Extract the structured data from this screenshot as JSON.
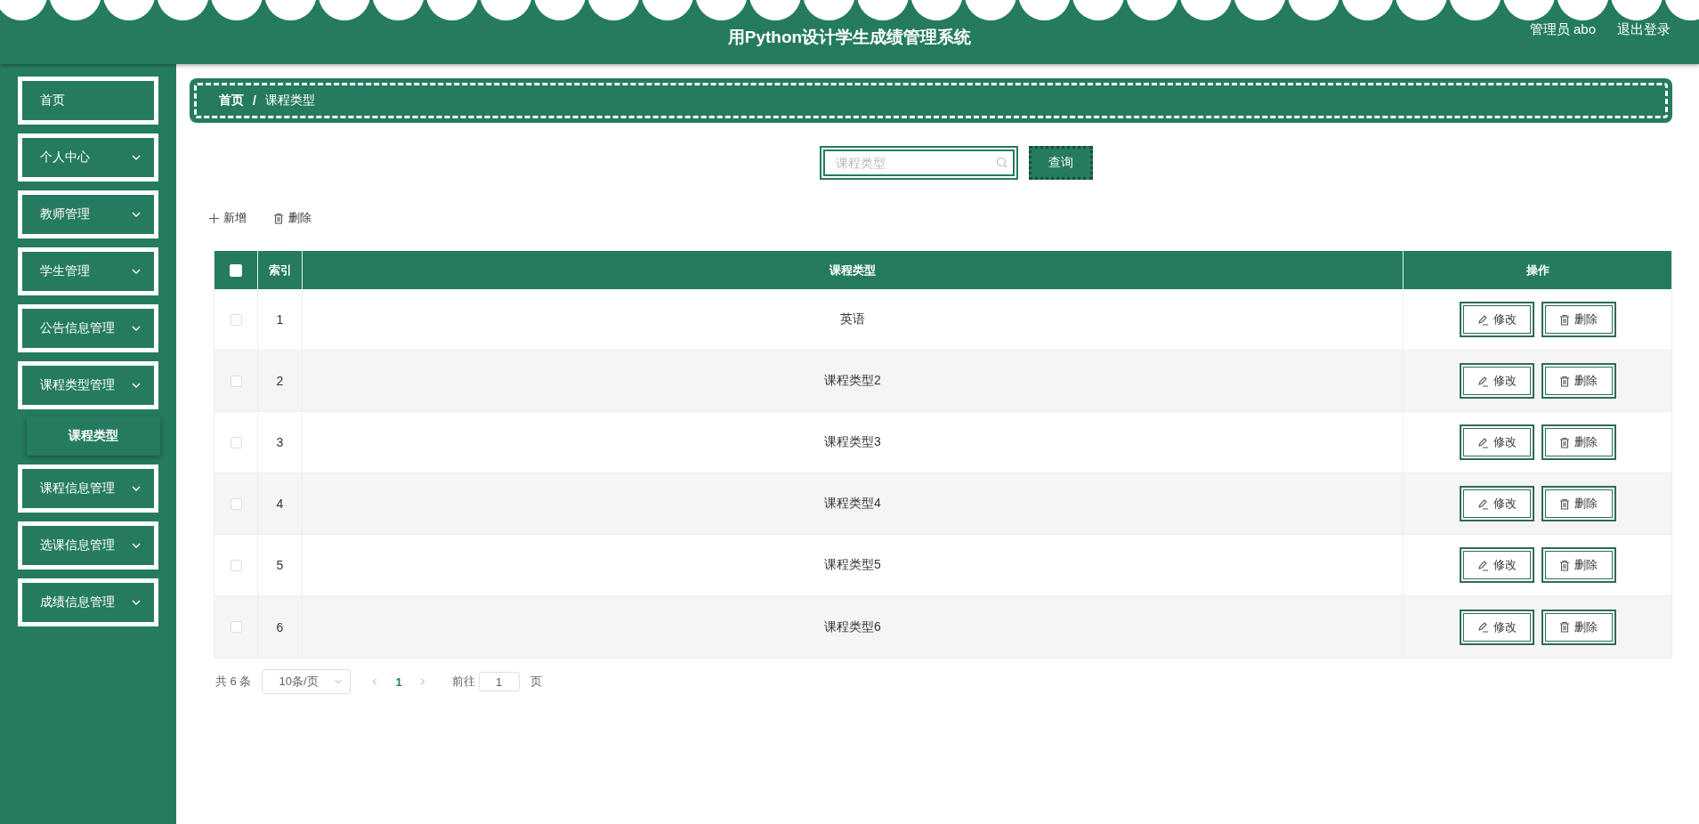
{
  "header": {
    "title": "用Python设计学生成绩管理系统",
    "user": "管理员 abo",
    "logout": "退出登录"
  },
  "sidebar": {
    "items": [
      {
        "label": "首页",
        "kind": "link"
      },
      {
        "label": "个人中心",
        "kind": "menu"
      },
      {
        "label": "教师管理",
        "kind": "menu"
      },
      {
        "label": "学生管理",
        "kind": "menu"
      },
      {
        "label": "公告信息管理",
        "kind": "menu"
      },
      {
        "label": "课程类型管理",
        "kind": "menu",
        "children": [
          {
            "label": "课程类型",
            "selected": true
          }
        ]
      },
      {
        "label": "课程信息管理",
        "kind": "menu"
      },
      {
        "label": "选课信息管理",
        "kind": "menu"
      },
      {
        "label": "成绩信息管理",
        "kind": "menu"
      }
    ]
  },
  "breadcrumb": [
    "首页",
    "课程类型"
  ],
  "breadcrumb_separator": "/",
  "search": {
    "placeholder": "课程类型",
    "button": "查询"
  },
  "toolbar": {
    "add": "新增",
    "delete": "删除"
  },
  "table": {
    "columns": [
      "索引",
      "课程类型",
      "操作"
    ],
    "select_all_checked": false,
    "rows": [
      {
        "index": "1",
        "type": "英语",
        "checked": false,
        "edit": "修改",
        "delete": "删除"
      },
      {
        "index": "2",
        "type": "课程类型2",
        "checked": false,
        "edit": "修改",
        "delete": "删除"
      },
      {
        "index": "3",
        "type": "课程类型3",
        "checked": false,
        "edit": "修改",
        "delete": "删除"
      },
      {
        "index": "4",
        "type": "课程类型4",
        "checked": false,
        "edit": "修改",
        "delete": "删除"
      },
      {
        "index": "5",
        "type": "课程类型5",
        "checked": false,
        "edit": "修改",
        "delete": "删除"
      },
      {
        "index": "6",
        "type": "课程类型6",
        "checked": false,
        "edit": "修改",
        "delete": "删除"
      }
    ]
  },
  "pagination": {
    "total": "共 6 条",
    "page_size": "10条/页",
    "pages": [
      {
        "label": "1",
        "selected": true
      }
    ],
    "goto_label": "前往",
    "goto_value": "1",
    "goto_suffix": "页"
  }
}
